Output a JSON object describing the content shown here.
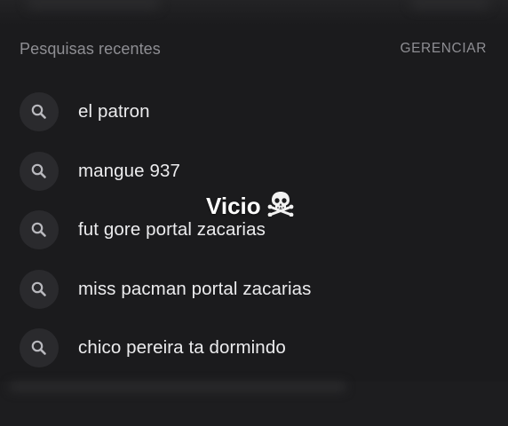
{
  "header": {
    "title": "Pesquisas recentes",
    "manage_label": "GERENCIAR"
  },
  "recent_searches": [
    {
      "label": "el patron",
      "icon": "search-icon"
    },
    {
      "label": "mangue 937",
      "icon": "search-icon"
    },
    {
      "label": "fut gore portal zacarias",
      "icon": "search-icon"
    },
    {
      "label": "miss pacman portal zacarias",
      "icon": "search-icon"
    },
    {
      "label": "chico pereira ta dormindo",
      "icon": "search-icon"
    }
  ],
  "overlay": {
    "caption": "Vicio",
    "emoji_icon": "skull-crossbones-icon"
  },
  "colors": {
    "background": "#1b1b1d",
    "icon_circle": "#2a2a2d",
    "secondary_text": "#8e8e93",
    "primary_text": "#ececee"
  }
}
